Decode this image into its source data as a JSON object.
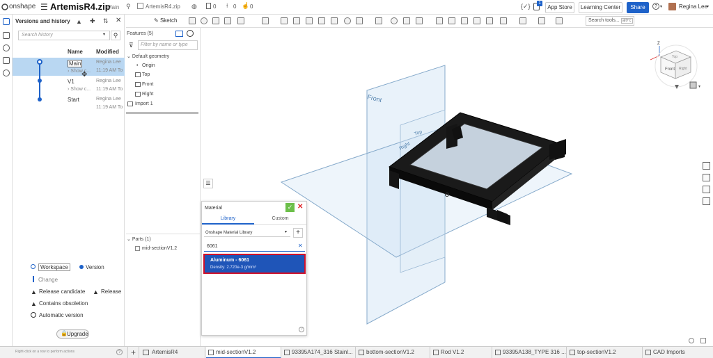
{
  "topbar": {
    "logo": "onshape",
    "doc_title": "ArtemisR4.zip",
    "branch": "Main",
    "crumb": "ArtemisR4.zip",
    "count_docs": "0",
    "count_versions": "0",
    "count_likes": "0",
    "notifications": "1",
    "app_store": "App Store",
    "learning_center": "Learning Center",
    "share": "Share",
    "user": "Regina Lee"
  },
  "toolbar": {
    "sketch": "Sketch",
    "search_tools": "Search tools...",
    "shortcut": "alt+c"
  },
  "versions": {
    "title": "Versions and history",
    "search_placeholder": "Search history",
    "col_name": "Name",
    "col_modified": "Modified",
    "rows": [
      {
        "name": "Main",
        "sub": "Show c...",
        "user": "Regina Lee",
        "time": "11:19 AM To"
      },
      {
        "name": "V1",
        "sub": "Show c...",
        "user": "Regina Lee",
        "time": "11:19 AM To"
      },
      {
        "name": "Start",
        "sub": "",
        "user": "Regina Lee",
        "time": "11:19 AM To"
      }
    ],
    "legend": {
      "workspace": "Workspace",
      "version": "Version",
      "change": "Change",
      "release_candidate": "Release candidate",
      "release": "Release",
      "contains_obsoletion": "Contains obsoletion",
      "automatic_version": "Automatic version"
    },
    "upgrade": "Upgrade",
    "hint": "Right-click on a row to perform actions"
  },
  "features": {
    "title": "Features (5)",
    "filter_placeholder": "Filter by name or type",
    "default_geometry": "Default geometry",
    "items": [
      "Origin",
      "Top",
      "Front",
      "Right"
    ],
    "import": "Import 1",
    "parts_title": "Parts (1)",
    "part": "mid-sectionV1.2"
  },
  "material": {
    "title": "Material",
    "tab_library": "Library",
    "tab_custom": "Custom",
    "library_select": "Onshape Material Library",
    "search_value": "6061",
    "result_name": "Aluminum - 6061",
    "result_density": "Density: 2.720e-3 g/mm³"
  },
  "viewport": {
    "plane_front": "Front",
    "plane_top": "Top",
    "plane_right": "Right",
    "cube_front": "Front",
    "cube_top": "Top",
    "cube_right": "Right"
  },
  "bottom_tabs": [
    "ArtemisR4",
    "mid-sectionV1.2",
    "93395A174_316 Stainl...",
    "bottom-sectionV1.2",
    "Rod V1.2",
    "93395A138_TYPE 316 ...",
    "top-sectionV1.2",
    "CAD Imports"
  ],
  "colors": {
    "accent": "#1e62c9",
    "selection": "#b9d7f2",
    "highlight_border": "#d0102a",
    "confirm": "#6cbf4a",
    "cancel": "#e0262a"
  }
}
